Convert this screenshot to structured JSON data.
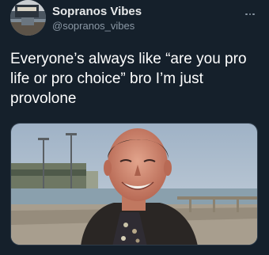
{
  "tweet": {
    "author": {
      "display_name": "Sopranos Vibes",
      "handle": "@sopranos_vibes",
      "avatar_icon": "avatar-image"
    },
    "more_icon": "ellipsis-icon",
    "text": "Everyone’s always like “are you pro life or pro choice” bro I’m just provolone",
    "media": {
      "type": "photo",
      "icon": "photo-image"
    }
  },
  "colors": {
    "background": "#15202b",
    "text_primary": "#ffffff",
    "text_secondary": "#8b98a5"
  }
}
